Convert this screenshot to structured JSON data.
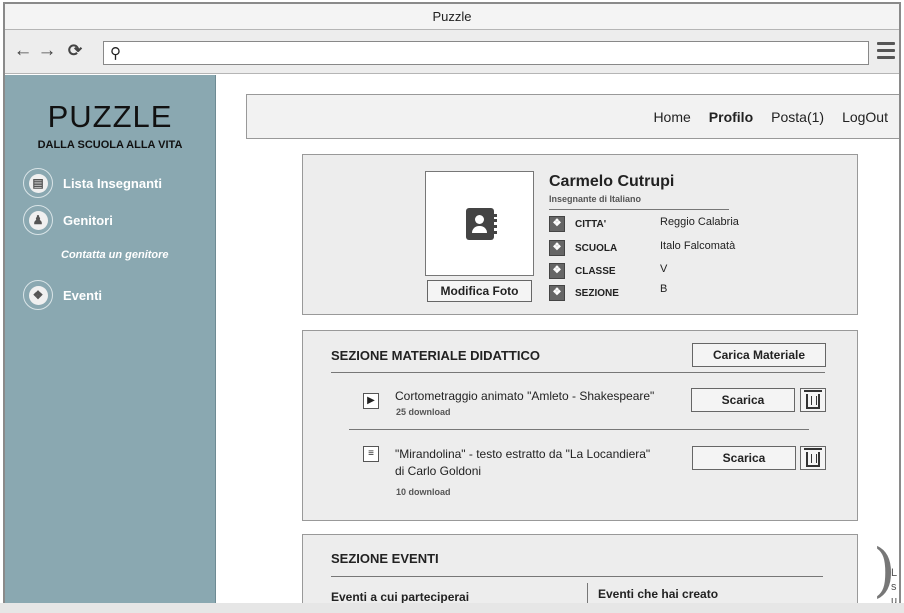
{
  "window": {
    "title": "Puzzle"
  },
  "browser": {
    "back": "←",
    "forward": "→",
    "reload": "⟳",
    "search_glyph": "⚲",
    "url": ""
  },
  "sidebar": {
    "logo_title": "PUZZLE",
    "logo_subtitle": "DALLA SCUOLA ALLA VITA",
    "items": [
      {
        "label": "Lista Insegnanti",
        "icon": "book-icon"
      },
      {
        "label": "Genitori",
        "icon": "person-icon"
      },
      {
        "label": "Eventi",
        "icon": "puzzle-icon"
      }
    ],
    "sub_item": "Contatta un genitore"
  },
  "nav": {
    "links": [
      "Home",
      "Profilo",
      "Posta(1)",
      "LogOut"
    ],
    "active": "Profilo"
  },
  "profile": {
    "name": "Carmelo Cutrupi",
    "role": "Insegnante di Italiano",
    "photo_button": "Modifica Foto",
    "fields": [
      {
        "label": "CITTA'",
        "value": "Reggio Calabria"
      },
      {
        "label": "SCUOLA",
        "value": "Italo Falcomatà"
      },
      {
        "label": "CLASSE",
        "value": "V"
      },
      {
        "label": "SEZIONE",
        "value": "B"
      }
    ]
  },
  "materials": {
    "title": "SEZIONE MATERIALE DIDATTICO",
    "upload_button": "Carica Materiale",
    "download_label": "Scarica",
    "items": [
      {
        "title_line1": "Cortometraggio animato \"Amleto - Shakespeare\"",
        "title_line2": "",
        "downloads": "25 download",
        "icon": "video-file-icon"
      },
      {
        "title_line1": "\"Mirandolina\" - testo estratto da \"La Locandiera\"",
        "title_line2": "di Carlo Goldoni",
        "downloads": "10 download",
        "icon": "document-file-icon"
      }
    ]
  },
  "events": {
    "title": "SEZIONE EVENTI",
    "col_left": "Eventi a cui parteciperai",
    "col_right": "Eventi che hai creato"
  },
  "side_note": {
    "line1": "L",
    "line2": "s",
    "line3": "u"
  },
  "colors": {
    "sidebar": "#8aa8b1",
    "panel": "#ededed"
  }
}
